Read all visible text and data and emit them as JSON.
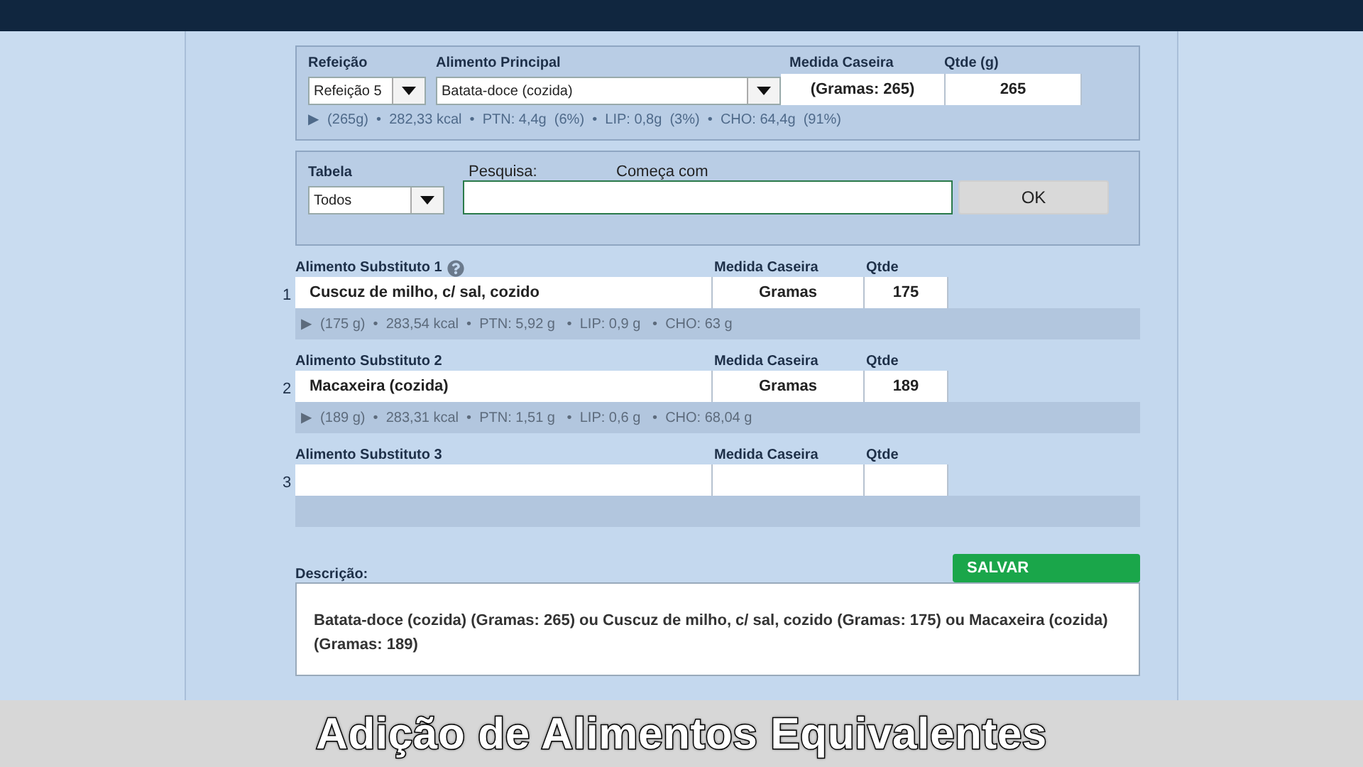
{
  "main_food": {
    "meal_label": "Refeição",
    "meal_value": "Refeição 5",
    "food_label": "Alimento Principal",
    "food_value": "Batata-doce (cozida)",
    "measure_label": "Medida Caseira",
    "measure_value": "(Gramas: 265)",
    "qty_label": "Qtde (g)",
    "qty_value": "265",
    "summary": "▶  (265g)  •  282,33 kcal  •  PTN: 4,4g  (6%)  •  LIP: 0,8g  (3%)  •  CHO: 64,4g  (91%)"
  },
  "search": {
    "table_label": "Tabela",
    "table_value": "Todos",
    "search_label": "Pesquisa:",
    "mode_label": "Começa com",
    "button": "OK"
  },
  "substitutes": [
    {
      "number": "1",
      "label": "Alimento Substituto 1",
      "help": true,
      "measure_label": "Medida Caseira",
      "qty_label": "Qtde",
      "food": "Cuscuz de milho, c/ sal, cozido",
      "measure": "Gramas",
      "qty": "175",
      "summary": "▶  (175 g)  •  283,54 kcal  •  PTN: 5,92 g   •  LIP: 0,9 g   •  CHO: 63 g"
    },
    {
      "number": "2",
      "label": "Alimento Substituto 2",
      "help": false,
      "measure_label": "Medida Caseira",
      "qty_label": "Qtde",
      "food": "Macaxeira (cozida)",
      "measure": "Gramas",
      "qty": "189",
      "summary": "▶  (189 g)  •  283,31 kcal  •  PTN: 1,51 g   •  LIP: 0,6 g   •  CHO: 68,04 g"
    },
    {
      "number": "3",
      "label": "Alimento Substituto 3",
      "help": false,
      "measure_label": "Medida Caseira",
      "qty_label": "Qtde"
    }
  ],
  "description": {
    "label": "Descrição:",
    "save_button": "SALVAR",
    "text": "Batata-doce (cozida) (Gramas: 265)  ou Cuscuz de milho, c/ sal, cozido (Gramas: 175) ou Macaxeira (cozida) (Gramas: 189)"
  },
  "caption": "Adição de Alimentos Equivalentes"
}
